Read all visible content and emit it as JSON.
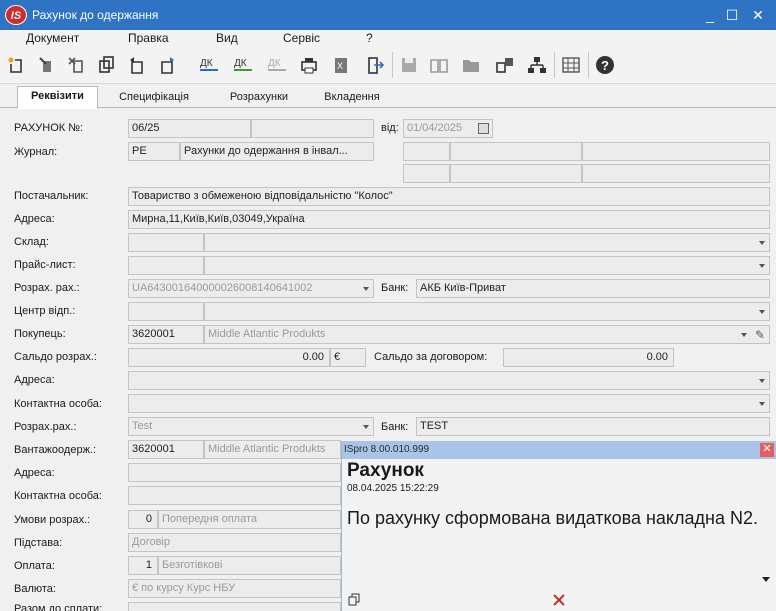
{
  "window": {
    "title": "Рахунок до одержання",
    "logo": "IS",
    "minimize": "_",
    "maximize": "☐",
    "close": "✕"
  },
  "menu": [
    "Документ",
    "Правка",
    "Вид",
    "Сервіс",
    "?"
  ],
  "tabs": [
    "Реквізити",
    "Специфікація",
    "Розрахунки",
    "Вкладення"
  ],
  "labels": {
    "invoice_no": "РАХУНОК №:",
    "from": "від:",
    "journal": "Журнал:",
    "supplier": "Постачальник:",
    "address": "Адреса:",
    "warehouse": "Склад:",
    "price_list": "Прайс-лист:",
    "settlement_account": "Розрах. рах.:",
    "bank": "Банк:",
    "dept_center": "Центр відп.:",
    "buyer": "Покупець:",
    "balance": "Сальдо розрах.:",
    "contract_balance": "Сальдо за договором:",
    "address2": "Адреса:",
    "contact": "Контактна особа:",
    "settlement_account2": "Розрах.рах.:",
    "bank2": "Банк:",
    "consignee": "Вантажоодерж.:",
    "address3": "Адреса:",
    "contact2": "Контактна особа:",
    "payment_terms": "Умови розрах.:",
    "basis": "Підстава:",
    "payment": "Оплата:",
    "currency": "Валюта:",
    "total": "Разом до сплати:"
  },
  "values": {
    "invoice_no": "06/25",
    "date": "01/04/2025",
    "journal_code": "РЕ",
    "journal_name": "Рахунки до одержання в інвал...",
    "supplier": "Товариство з обмеженою відповідальністю \"Колос\"",
    "address": "Мирна,11,Київ,Київ,03049,Україна",
    "account": "UA643001640000026008140641002",
    "bank": "АКБ Київ-Приват",
    "buyer_code": "3620001",
    "buyer_name": "Middle Atlantic Produkts",
    "balance": "0.00",
    "balance_currency": "€",
    "contract_balance": "0.00",
    "account2": "Test",
    "bank2": "TEST",
    "consignee_code": "3620001",
    "consignee_name": "Middle Atlantic Produkts",
    "terms_code": "0",
    "terms_name": "Попередня оплата",
    "basis": "Договір",
    "payment_code": "1",
    "payment_name": "Безготівкові",
    "currency": "€ по курсу Курс НБУ"
  },
  "toast": {
    "header": "ISpro 8.00.010.999",
    "title": "Рахунок",
    "time": "08.04.2025 15:22:29",
    "message": "По рахунку сформована видаткова накладна N2."
  }
}
